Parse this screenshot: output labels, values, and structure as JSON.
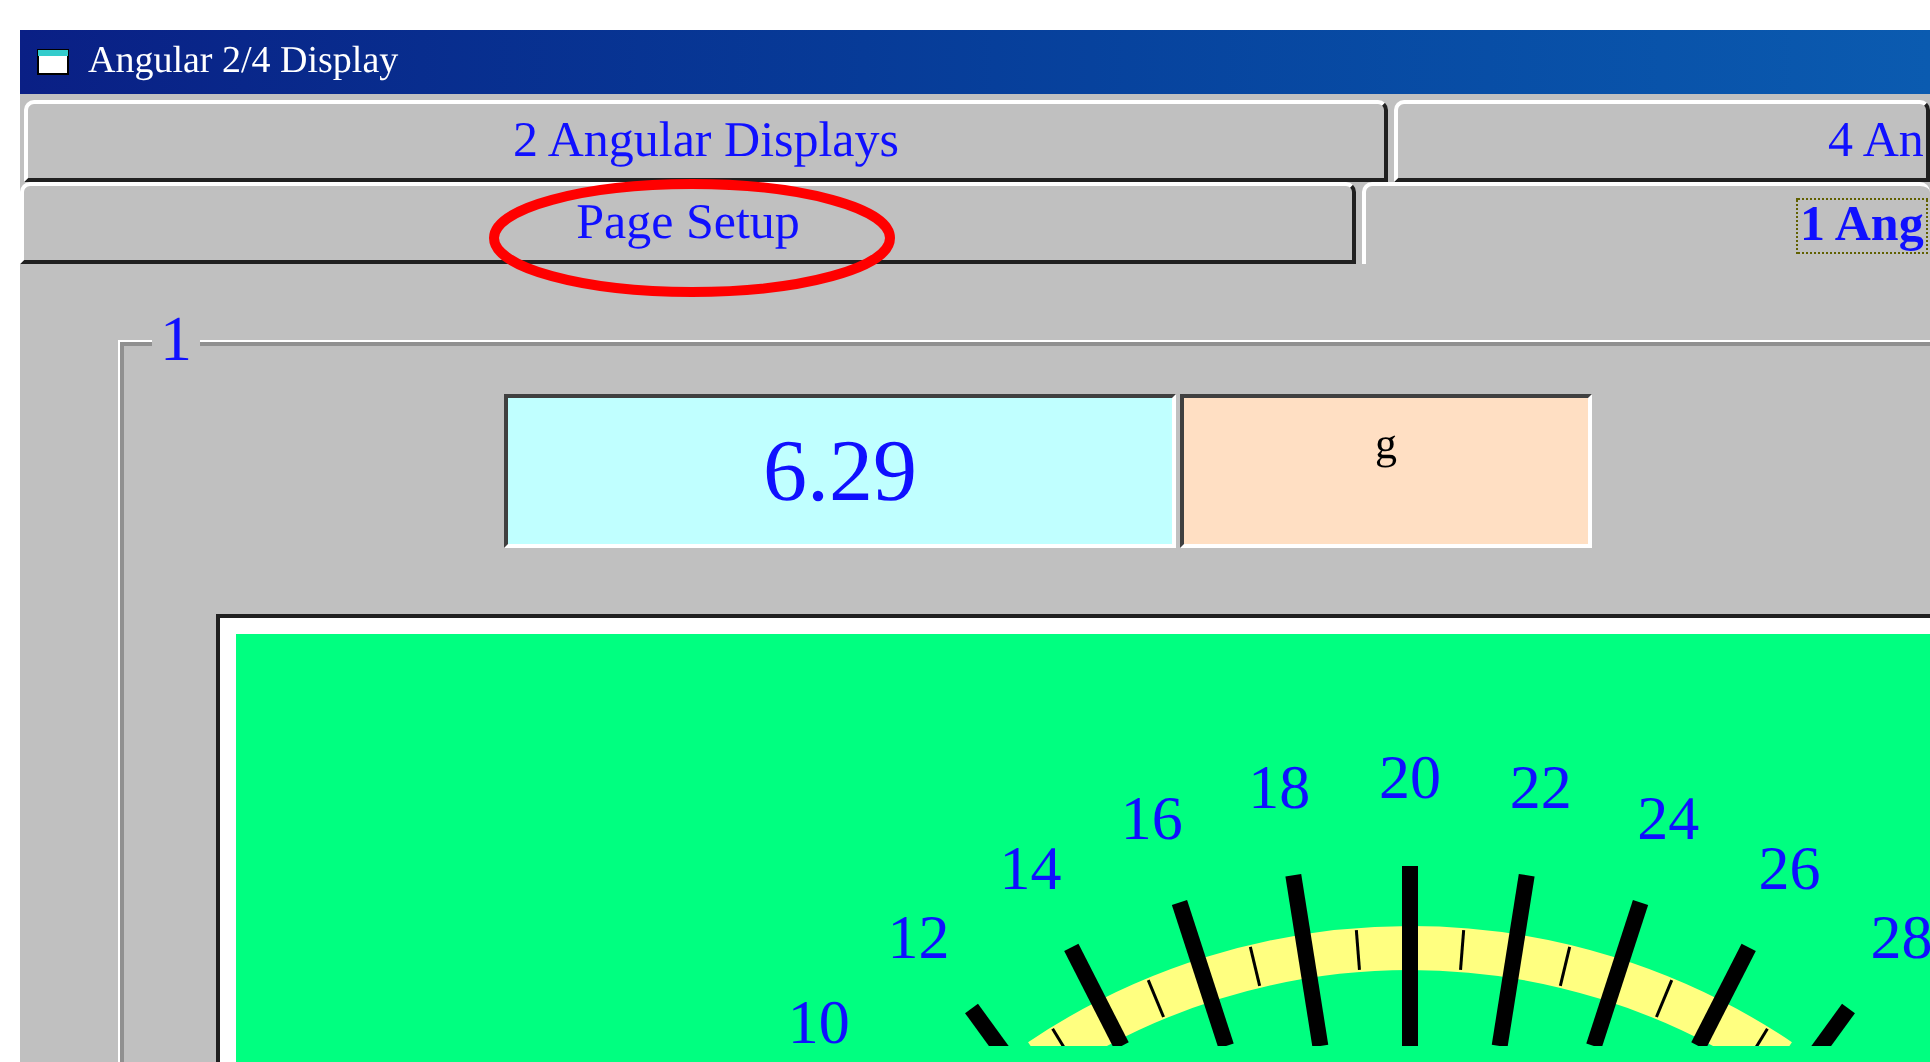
{
  "window": {
    "title": "Angular 2/4 Display"
  },
  "tab_rows": [
    [
      {
        "label": "2 Angular Displays",
        "selected": false,
        "circled": false
      },
      {
        "label": "4 An",
        "selected": false,
        "circled": false
      }
    ],
    [
      {
        "label": "Page Setup",
        "selected": false,
        "circled": true
      },
      {
        "label": "1 Ang",
        "selected": true,
        "circled": false
      }
    ]
  ],
  "group": {
    "title": "1",
    "reading": "6.29",
    "unit": "g",
    "dial_labels": [
      "10",
      "12",
      "14",
      "16",
      "18",
      "20",
      "22",
      "24",
      "26",
      "28"
    ]
  }
}
